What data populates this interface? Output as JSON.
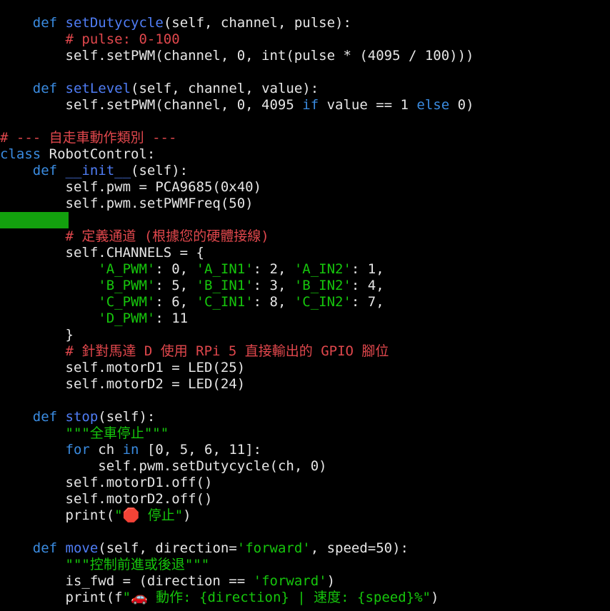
{
  "terminal": {
    "highlight_color": "#13a10e",
    "colors": {
      "background": "#000000",
      "plain": "#e6e6e6",
      "keyword": "#3a8be0",
      "function": "#4f7df5",
      "comment": "#e0474c",
      "string": "#16c60c"
    },
    "lines": [
      {
        "indent": "    ",
        "tokens": [
          {
            "t": "keyword",
            "v": "def "
          },
          {
            "t": "func",
            "v": "setDutycycle"
          },
          {
            "t": "plain",
            "v": "(self, channel, pulse):"
          }
        ]
      },
      {
        "indent": "        ",
        "tokens": [
          {
            "t": "comment",
            "v": "# pulse: 0-100"
          }
        ]
      },
      {
        "indent": "        ",
        "tokens": [
          {
            "t": "plain",
            "v": "self.setPWM(channel, 0, int(pulse * (4095 / 100)))"
          }
        ]
      },
      {
        "indent": "",
        "tokens": []
      },
      {
        "indent": "    ",
        "tokens": [
          {
            "t": "keyword",
            "v": "def "
          },
          {
            "t": "func",
            "v": "setLevel"
          },
          {
            "t": "plain",
            "v": "(self, channel, value):"
          }
        ]
      },
      {
        "indent": "        ",
        "tokens": [
          {
            "t": "plain",
            "v": "self.setPWM(channel, 0, 4095 "
          },
          {
            "t": "keyword",
            "v": "if"
          },
          {
            "t": "plain",
            "v": " value == 1 "
          },
          {
            "t": "keyword",
            "v": "else"
          },
          {
            "t": "plain",
            "v": " 0)"
          }
        ]
      },
      {
        "indent": "",
        "tokens": []
      },
      {
        "indent": "",
        "tokens": [
          {
            "t": "comment",
            "v": "# --- 自走車動作類別 ---"
          }
        ]
      },
      {
        "indent": "",
        "tokens": [
          {
            "t": "keyword",
            "v": "class"
          },
          {
            "t": "plain",
            "v": " RobotControl:"
          }
        ]
      },
      {
        "indent": "    ",
        "tokens": [
          {
            "t": "keyword",
            "v": "def "
          },
          {
            "t": "func",
            "v": "__init__"
          },
          {
            "t": "plain",
            "v": "(self):"
          }
        ]
      },
      {
        "indent": "        ",
        "tokens": [
          {
            "t": "plain",
            "v": "self.pwm = PCA9685(0x40)"
          }
        ]
      },
      {
        "indent": "        ",
        "tokens": [
          {
            "t": "plain",
            "v": "self.pwm.setPWMFreq(50)"
          }
        ]
      },
      {
        "indent": "",
        "tokens": [],
        "highlight": true
      },
      {
        "indent": "        ",
        "tokens": [
          {
            "t": "comment",
            "v": "# 定義通道 (根據您的硬體接線)"
          }
        ]
      },
      {
        "indent": "        ",
        "tokens": [
          {
            "t": "plain",
            "v": "self.CHANNELS = {"
          }
        ]
      },
      {
        "indent": "            ",
        "tokens": [
          {
            "t": "string",
            "v": "'A_PWM'"
          },
          {
            "t": "plain",
            "v": ": 0, "
          },
          {
            "t": "string",
            "v": "'A_IN1'"
          },
          {
            "t": "plain",
            "v": ": 2, "
          },
          {
            "t": "string",
            "v": "'A_IN2'"
          },
          {
            "t": "plain",
            "v": ": 1,"
          }
        ]
      },
      {
        "indent": "            ",
        "tokens": [
          {
            "t": "string",
            "v": "'B_PWM'"
          },
          {
            "t": "plain",
            "v": ": 5, "
          },
          {
            "t": "string",
            "v": "'B_IN1'"
          },
          {
            "t": "plain",
            "v": ": 3, "
          },
          {
            "t": "string",
            "v": "'B_IN2'"
          },
          {
            "t": "plain",
            "v": ": 4,"
          }
        ]
      },
      {
        "indent": "            ",
        "tokens": [
          {
            "t": "string",
            "v": "'C_PWM'"
          },
          {
            "t": "plain",
            "v": ": 6, "
          },
          {
            "t": "string",
            "v": "'C_IN1'"
          },
          {
            "t": "plain",
            "v": ": 8, "
          },
          {
            "t": "string",
            "v": "'C_IN2'"
          },
          {
            "t": "plain",
            "v": ": 7,"
          }
        ]
      },
      {
        "indent": "            ",
        "tokens": [
          {
            "t": "string",
            "v": "'D_PWM'"
          },
          {
            "t": "plain",
            "v": ": 11"
          }
        ]
      },
      {
        "indent": "        ",
        "tokens": [
          {
            "t": "plain",
            "v": "}"
          }
        ]
      },
      {
        "indent": "        ",
        "tokens": [
          {
            "t": "comment",
            "v": "# 針對馬達 D 使用 RPi 5 直接輸出的 GPIO 腳位"
          }
        ]
      },
      {
        "indent": "        ",
        "tokens": [
          {
            "t": "plain",
            "v": "self.motorD1 = LED(25)"
          }
        ]
      },
      {
        "indent": "        ",
        "tokens": [
          {
            "t": "plain",
            "v": "self.motorD2 = LED(24)"
          }
        ]
      },
      {
        "indent": "",
        "tokens": []
      },
      {
        "indent": "    ",
        "tokens": [
          {
            "t": "keyword",
            "v": "def "
          },
          {
            "t": "func",
            "v": "stop"
          },
          {
            "t": "plain",
            "v": "(self):"
          }
        ]
      },
      {
        "indent": "        ",
        "tokens": [
          {
            "t": "string",
            "v": "\"\"\"全車停止\"\"\""
          }
        ]
      },
      {
        "indent": "        ",
        "tokens": [
          {
            "t": "keyword",
            "v": "for"
          },
          {
            "t": "plain",
            "v": " ch "
          },
          {
            "t": "keyword",
            "v": "in"
          },
          {
            "t": "plain",
            "v": " [0, 5, 6, 11]:"
          }
        ]
      },
      {
        "indent": "            ",
        "tokens": [
          {
            "t": "plain",
            "v": "self.pwm.setDutycycle(ch, 0)"
          }
        ]
      },
      {
        "indent": "        ",
        "tokens": [
          {
            "t": "plain",
            "v": "self.motorD1.off()"
          }
        ]
      },
      {
        "indent": "        ",
        "tokens": [
          {
            "t": "plain",
            "v": "self.motorD2.off()"
          }
        ]
      },
      {
        "indent": "        ",
        "tokens": [
          {
            "t": "plain",
            "v": "print("
          },
          {
            "t": "string",
            "v": "\"🛑 停止\""
          },
          {
            "t": "plain",
            "v": ")"
          }
        ]
      },
      {
        "indent": "",
        "tokens": []
      },
      {
        "indent": "    ",
        "tokens": [
          {
            "t": "keyword",
            "v": "def "
          },
          {
            "t": "func",
            "v": "move"
          },
          {
            "t": "plain",
            "v": "(self, direction="
          },
          {
            "t": "string",
            "v": "'forward'"
          },
          {
            "t": "plain",
            "v": ", speed=50):"
          }
        ]
      },
      {
        "indent": "        ",
        "tokens": [
          {
            "t": "string",
            "v": "\"\"\"控制前進或後退\"\"\""
          }
        ]
      },
      {
        "indent": "        ",
        "tokens": [
          {
            "t": "plain",
            "v": "is_fwd = (direction == "
          },
          {
            "t": "string",
            "v": "'forward'"
          },
          {
            "t": "plain",
            "v": ")"
          }
        ]
      },
      {
        "indent": "        ",
        "tokens": [
          {
            "t": "plain",
            "v": "print(f"
          },
          {
            "t": "string",
            "v": "\"🚗 動作: {direction} | 速度: {speed}%\""
          },
          {
            "t": "plain",
            "v": ")"
          }
        ]
      }
    ]
  }
}
